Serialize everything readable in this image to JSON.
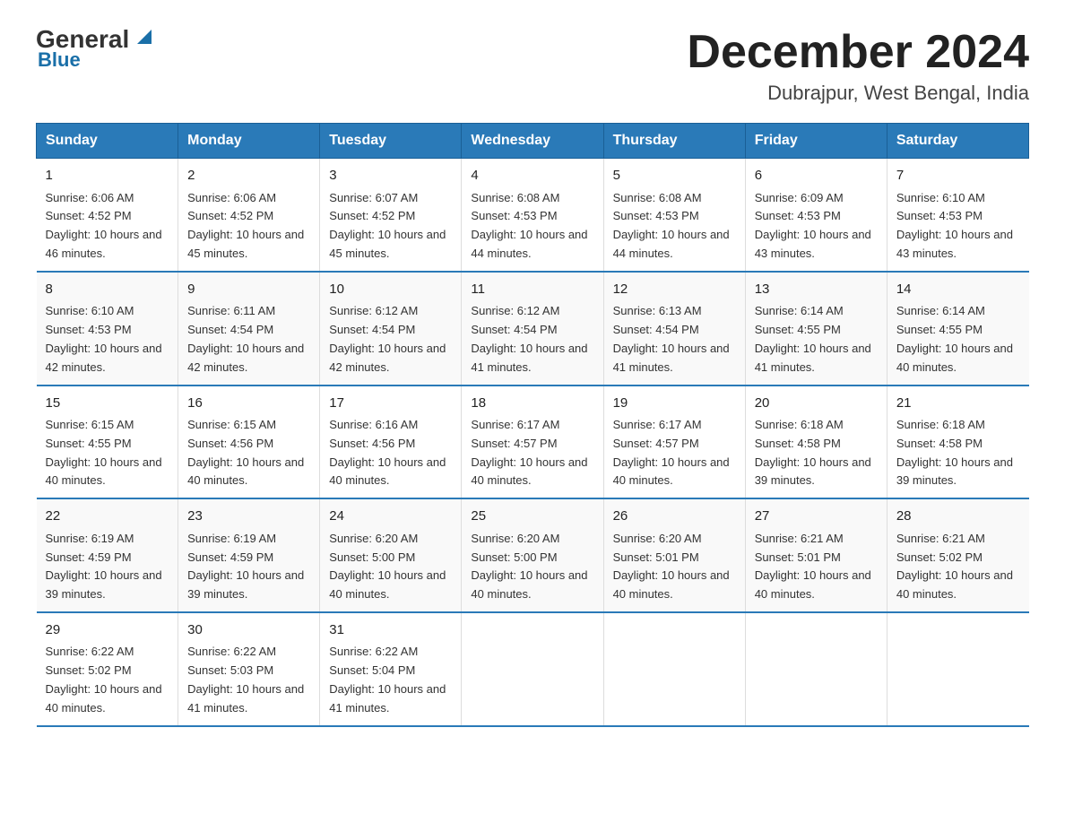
{
  "logo": {
    "name": "General",
    "suffix": "Blue",
    "subtitle": "Blue"
  },
  "header": {
    "month": "December 2024",
    "location": "Dubrajpur, West Bengal, India"
  },
  "days_of_week": [
    "Sunday",
    "Monday",
    "Tuesday",
    "Wednesday",
    "Thursday",
    "Friday",
    "Saturday"
  ],
  "weeks": [
    [
      {
        "day": "1",
        "sunrise": "6:06 AM",
        "sunset": "4:52 PM",
        "daylight": "10 hours and 46 minutes."
      },
      {
        "day": "2",
        "sunrise": "6:06 AM",
        "sunset": "4:52 PM",
        "daylight": "10 hours and 45 minutes."
      },
      {
        "day": "3",
        "sunrise": "6:07 AM",
        "sunset": "4:52 PM",
        "daylight": "10 hours and 45 minutes."
      },
      {
        "day": "4",
        "sunrise": "6:08 AM",
        "sunset": "4:53 PM",
        "daylight": "10 hours and 44 minutes."
      },
      {
        "day": "5",
        "sunrise": "6:08 AM",
        "sunset": "4:53 PM",
        "daylight": "10 hours and 44 minutes."
      },
      {
        "day": "6",
        "sunrise": "6:09 AM",
        "sunset": "4:53 PM",
        "daylight": "10 hours and 43 minutes."
      },
      {
        "day": "7",
        "sunrise": "6:10 AM",
        "sunset": "4:53 PM",
        "daylight": "10 hours and 43 minutes."
      }
    ],
    [
      {
        "day": "8",
        "sunrise": "6:10 AM",
        "sunset": "4:53 PM",
        "daylight": "10 hours and 42 minutes."
      },
      {
        "day": "9",
        "sunrise": "6:11 AM",
        "sunset": "4:54 PM",
        "daylight": "10 hours and 42 minutes."
      },
      {
        "day": "10",
        "sunrise": "6:12 AM",
        "sunset": "4:54 PM",
        "daylight": "10 hours and 42 minutes."
      },
      {
        "day": "11",
        "sunrise": "6:12 AM",
        "sunset": "4:54 PM",
        "daylight": "10 hours and 41 minutes."
      },
      {
        "day": "12",
        "sunrise": "6:13 AM",
        "sunset": "4:54 PM",
        "daylight": "10 hours and 41 minutes."
      },
      {
        "day": "13",
        "sunrise": "6:14 AM",
        "sunset": "4:55 PM",
        "daylight": "10 hours and 41 minutes."
      },
      {
        "day": "14",
        "sunrise": "6:14 AM",
        "sunset": "4:55 PM",
        "daylight": "10 hours and 40 minutes."
      }
    ],
    [
      {
        "day": "15",
        "sunrise": "6:15 AM",
        "sunset": "4:55 PM",
        "daylight": "10 hours and 40 minutes."
      },
      {
        "day": "16",
        "sunrise": "6:15 AM",
        "sunset": "4:56 PM",
        "daylight": "10 hours and 40 minutes."
      },
      {
        "day": "17",
        "sunrise": "6:16 AM",
        "sunset": "4:56 PM",
        "daylight": "10 hours and 40 minutes."
      },
      {
        "day": "18",
        "sunrise": "6:17 AM",
        "sunset": "4:57 PM",
        "daylight": "10 hours and 40 minutes."
      },
      {
        "day": "19",
        "sunrise": "6:17 AM",
        "sunset": "4:57 PM",
        "daylight": "10 hours and 40 minutes."
      },
      {
        "day": "20",
        "sunrise": "6:18 AM",
        "sunset": "4:58 PM",
        "daylight": "10 hours and 39 minutes."
      },
      {
        "day": "21",
        "sunrise": "6:18 AM",
        "sunset": "4:58 PM",
        "daylight": "10 hours and 39 minutes."
      }
    ],
    [
      {
        "day": "22",
        "sunrise": "6:19 AM",
        "sunset": "4:59 PM",
        "daylight": "10 hours and 39 minutes."
      },
      {
        "day": "23",
        "sunrise": "6:19 AM",
        "sunset": "4:59 PM",
        "daylight": "10 hours and 39 minutes."
      },
      {
        "day": "24",
        "sunrise": "6:20 AM",
        "sunset": "5:00 PM",
        "daylight": "10 hours and 40 minutes."
      },
      {
        "day": "25",
        "sunrise": "6:20 AM",
        "sunset": "5:00 PM",
        "daylight": "10 hours and 40 minutes."
      },
      {
        "day": "26",
        "sunrise": "6:20 AM",
        "sunset": "5:01 PM",
        "daylight": "10 hours and 40 minutes."
      },
      {
        "day": "27",
        "sunrise": "6:21 AM",
        "sunset": "5:01 PM",
        "daylight": "10 hours and 40 minutes."
      },
      {
        "day": "28",
        "sunrise": "6:21 AM",
        "sunset": "5:02 PM",
        "daylight": "10 hours and 40 minutes."
      }
    ],
    [
      {
        "day": "29",
        "sunrise": "6:22 AM",
        "sunset": "5:02 PM",
        "daylight": "10 hours and 40 minutes."
      },
      {
        "day": "30",
        "sunrise": "6:22 AM",
        "sunset": "5:03 PM",
        "daylight": "10 hours and 41 minutes."
      },
      {
        "day": "31",
        "sunrise": "6:22 AM",
        "sunset": "5:04 PM",
        "daylight": "10 hours and 41 minutes."
      },
      {
        "day": "",
        "sunrise": "",
        "sunset": "",
        "daylight": ""
      },
      {
        "day": "",
        "sunrise": "",
        "sunset": "",
        "daylight": ""
      },
      {
        "day": "",
        "sunrise": "",
        "sunset": "",
        "daylight": ""
      },
      {
        "day": "",
        "sunrise": "",
        "sunset": "",
        "daylight": ""
      }
    ]
  ],
  "labels": {
    "sunrise": "Sunrise: ",
    "sunset": "Sunset: ",
    "daylight": "Daylight: "
  }
}
